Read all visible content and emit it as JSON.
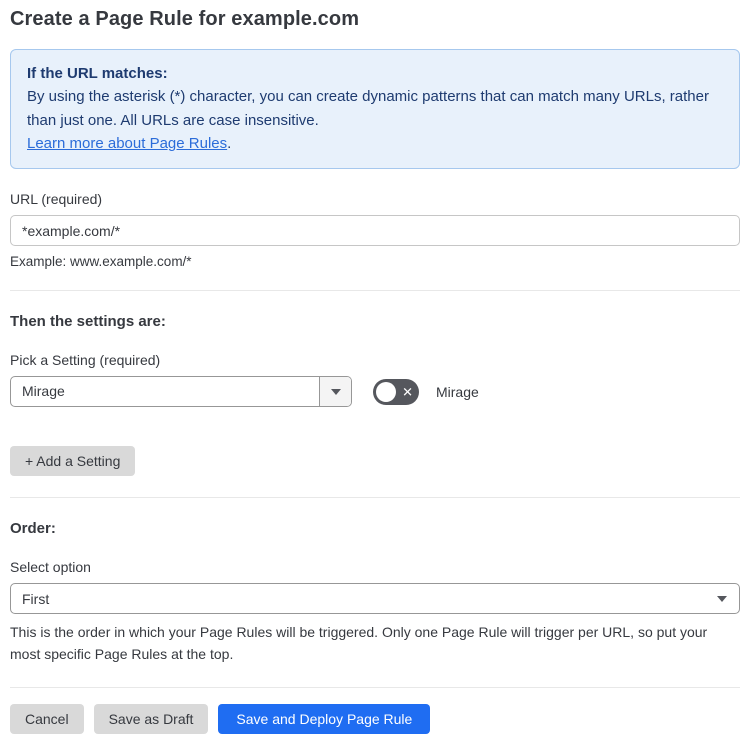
{
  "page": {
    "title": "Create a Page Rule for example.com"
  },
  "info_box": {
    "heading": "If the URL matches:",
    "body": "By using the asterisk (*) character, you can create dynamic patterns that can match many URLs, rather than just one. All URLs are case insensitive.",
    "link_label": "Learn more about Page Rules",
    "link_suffix": "."
  },
  "url_field": {
    "label": "URL (required)",
    "value": "*example.com/*",
    "example": "Example: www.example.com/*"
  },
  "settings_section": {
    "heading": "Then the settings are:",
    "picker_label": "Pick a Setting (required)",
    "selected_setting": "Mirage",
    "toggle_state": "off",
    "toggle_icon": "✕",
    "toggle_label": "Mirage",
    "add_setting_label": "+ Add a Setting"
  },
  "order_section": {
    "heading": "Order:",
    "select_label": "Select option",
    "selected_option": "First",
    "help_text": "This is the order in which your Page Rules will be triggered. Only one Page Rule will trigger per URL, so put your most specific Page Rules at the top."
  },
  "footer": {
    "cancel_label": "Cancel",
    "save_draft_label": "Save as Draft",
    "save_deploy_label": "Save and Deploy Page Rule"
  },
  "colors": {
    "info_bg": "#e8f1fb",
    "info_border": "#a6c8ee",
    "info_text": "#1e3b70",
    "link_blue": "#2b6cd9",
    "primary_blue": "#1f6df2",
    "gray_button": "#d9d9d9",
    "text_dark": "#36393f",
    "toggle_off": "#55575d"
  }
}
